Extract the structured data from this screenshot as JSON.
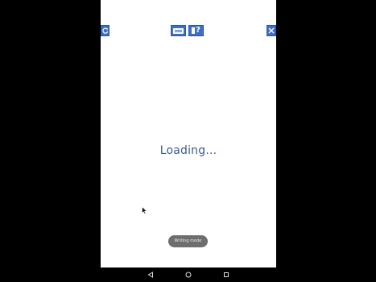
{
  "toolbar": {
    "refresh_icon": "refresh-icon",
    "keyboard_icon": "keyboard-icon",
    "help_icon": "help-icon",
    "help_glyph": "?",
    "close_icon": "close-icon",
    "accent_color": "#3f6fc4"
  },
  "main": {
    "loading_text": "Loading..."
  },
  "toast": {
    "text": "Writing mode"
  },
  "navigation": {
    "back_icon": "back-triangle-icon",
    "home_icon": "home-circle-icon",
    "recents_icon": "recents-square-icon"
  }
}
